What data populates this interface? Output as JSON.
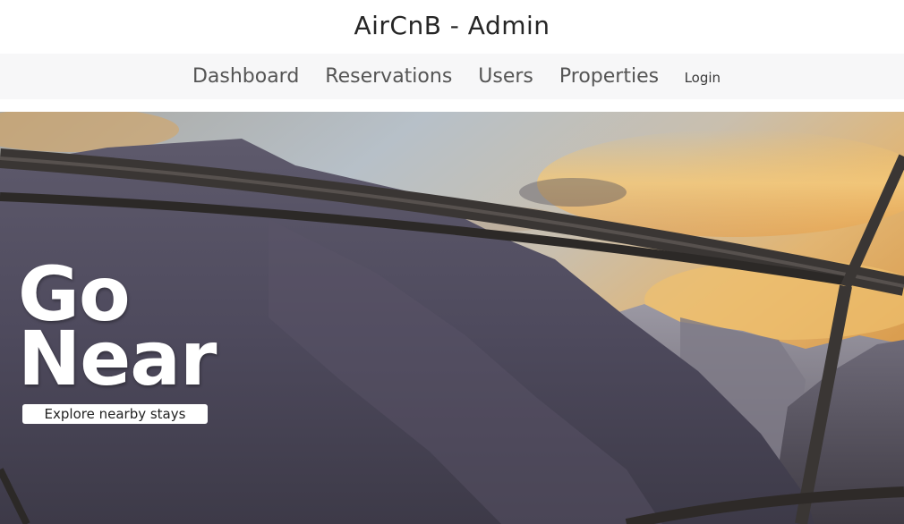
{
  "header": {
    "title": "AirCnB - Admin"
  },
  "nav": {
    "items": [
      {
        "label": "Dashboard"
      },
      {
        "label": "Reservations"
      },
      {
        "label": "Users"
      },
      {
        "label": "Properties"
      }
    ],
    "login_label": "Login"
  },
  "hero": {
    "title_line1": "Go",
    "title_line2": "Near",
    "cta_label": "Explore nearby stays",
    "image_description_icon": "mountain-landscape-image"
  },
  "colors": {
    "nav_background": "#f7f7f8",
    "nav_text": "#555555",
    "title_text": "#262626",
    "hero_text": "#ffffff",
    "cta_background": "#ffffff"
  }
}
